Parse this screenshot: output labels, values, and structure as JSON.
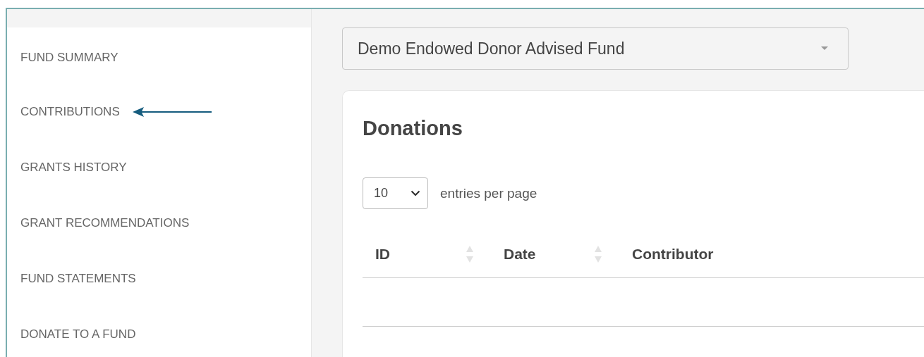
{
  "sidebar": {
    "items": [
      {
        "label": "FUND SUMMARY",
        "pointer": false
      },
      {
        "label": "CONTRIBUTIONS",
        "pointer": true
      },
      {
        "label": "GRANTS HISTORY",
        "pointer": false
      },
      {
        "label": "GRANT RECOMMENDATIONS",
        "pointer": false
      },
      {
        "label": "FUND STATEMENTS",
        "pointer": false
      },
      {
        "label": "DONATE TO A FUND",
        "pointer": false
      }
    ]
  },
  "fund_select": {
    "value": "Demo Endowed Donor Advised Fund"
  },
  "card": {
    "title": "Donations",
    "page_size": {
      "value": "10",
      "label": "entries per page"
    },
    "table": {
      "columns": [
        {
          "label": "ID",
          "sortable": true
        },
        {
          "label": "Date",
          "sortable": true
        },
        {
          "label": "Contributor",
          "sortable": false
        }
      ]
    }
  }
}
